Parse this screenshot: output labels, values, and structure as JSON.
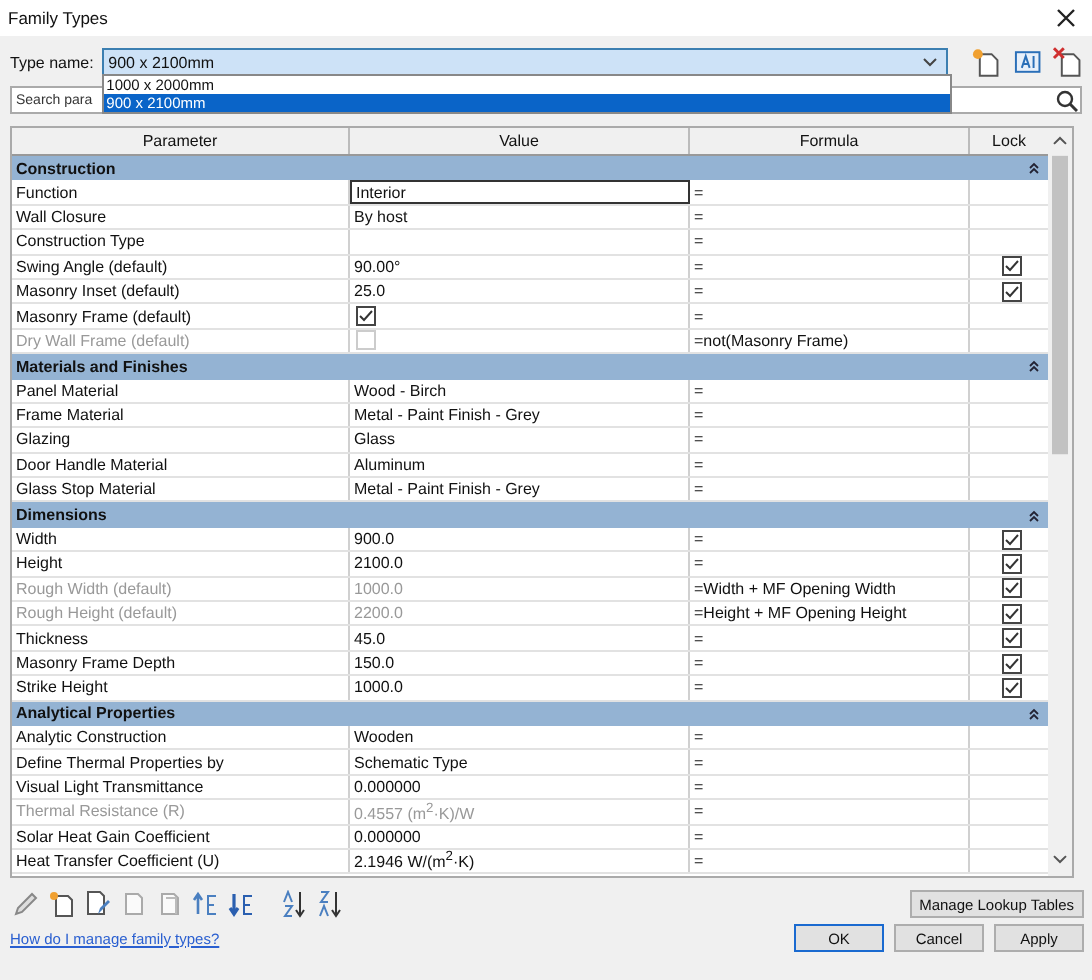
{
  "window": {
    "title": "Family Types"
  },
  "type_name": {
    "label": "Type name:",
    "value": "900 x 2100mm",
    "expanded": true,
    "options": [
      {
        "label": "1000 x 2000mm",
        "selected": false
      },
      {
        "label": "900 x 2100mm",
        "selected": true
      }
    ]
  },
  "search": {
    "placeholder": "Search para"
  },
  "table": {
    "columns": [
      "Parameter",
      "Value",
      "Formula",
      "Lock"
    ],
    "groups": [
      {
        "name": "Construction",
        "rows": [
          {
            "parameter": "Function",
            "kind": "text",
            "value": "Interior",
            "formula": "=",
            "locked": false,
            "disabled": false,
            "editing": true
          },
          {
            "parameter": "Wall Closure",
            "kind": "text",
            "value": "By host",
            "formula": "=",
            "locked": false,
            "disabled": false,
            "editing": false
          },
          {
            "parameter": "Construction Type",
            "kind": "text",
            "value": "",
            "formula": "=",
            "locked": false,
            "disabled": false,
            "editing": false
          },
          {
            "parameter": "Swing Angle (default)",
            "kind": "text",
            "value": "90.00°",
            "formula": "=",
            "locked": true,
            "disabled": false,
            "editing": false
          },
          {
            "parameter": "Masonry Inset (default)",
            "kind": "text",
            "value": "25.0",
            "formula": "=",
            "locked": true,
            "disabled": false,
            "editing": false
          },
          {
            "parameter": "Masonry Frame (default)",
            "kind": "checkbox",
            "checked": true,
            "formula": "=",
            "locked": false,
            "disabled": false,
            "editing": false
          },
          {
            "parameter": "Dry Wall Frame (default)",
            "kind": "checkbox",
            "checked": false,
            "formula": "=not(Masonry Frame)",
            "locked": false,
            "disabled": true,
            "editing": false
          }
        ]
      },
      {
        "name": "Materials and Finishes",
        "rows": [
          {
            "parameter": "Panel Material",
            "kind": "text",
            "value": "Wood - Birch",
            "formula": "=",
            "locked": false,
            "disabled": false,
            "editing": false
          },
          {
            "parameter": "Frame Material",
            "kind": "text",
            "value": "Metal - Paint Finish - Grey",
            "formula": "=",
            "locked": false,
            "disabled": false,
            "editing": false
          },
          {
            "parameter": "Glazing",
            "kind": "text",
            "value": "Glass",
            "formula": "=",
            "locked": false,
            "disabled": false,
            "editing": false
          },
          {
            "parameter": "Door Handle Material",
            "kind": "text",
            "value": "Aluminum",
            "formula": "=",
            "locked": false,
            "disabled": false,
            "editing": false
          },
          {
            "parameter": "Glass Stop Material",
            "kind": "text",
            "value": "Metal - Paint Finish - Grey",
            "formula": "=",
            "locked": false,
            "disabled": false,
            "editing": false
          }
        ]
      },
      {
        "name": "Dimensions",
        "rows": [
          {
            "parameter": "Width",
            "kind": "text",
            "value": "900.0",
            "formula": "=",
            "locked": true,
            "disabled": false,
            "editing": false
          },
          {
            "parameter": "Height",
            "kind": "text",
            "value": "2100.0",
            "formula": "=",
            "locked": true,
            "disabled": false,
            "editing": false
          },
          {
            "parameter": "Rough Width (default)",
            "kind": "text",
            "value": "1000.0",
            "formula": "=Width + MF Opening Width",
            "locked": true,
            "disabled": true,
            "editing": false
          },
          {
            "parameter": "Rough Height (default)",
            "kind": "text",
            "value": "2200.0",
            "formula": "=Height + MF Opening Height",
            "locked": true,
            "disabled": true,
            "editing": false
          },
          {
            "parameter": "Thickness",
            "kind": "text",
            "value": "45.0",
            "formula": "=",
            "locked": true,
            "disabled": false,
            "editing": false
          },
          {
            "parameter": "Masonry Frame Depth",
            "kind": "text",
            "value": "150.0",
            "formula": "=",
            "locked": true,
            "disabled": false,
            "editing": false
          },
          {
            "parameter": "Strike Height",
            "kind": "text",
            "value": "1000.0",
            "formula": "=",
            "locked": true,
            "disabled": false,
            "editing": false
          }
        ]
      },
      {
        "name": "Analytical Properties",
        "rows": [
          {
            "parameter": "Analytic Construction",
            "kind": "text",
            "value": "Wooden",
            "formula": "=",
            "locked": false,
            "disabled": false,
            "editing": false
          },
          {
            "parameter": "Define Thermal Properties by",
            "kind": "text",
            "value": "Schematic Type",
            "formula": "=",
            "locked": false,
            "disabled": false,
            "editing": false
          },
          {
            "parameter": "Visual Light Transmittance",
            "kind": "text",
            "value": "0.000000",
            "formula": "=",
            "locked": false,
            "disabled": false,
            "editing": false
          },
          {
            "parameter": "Thermal Resistance (R)",
            "kind": "text",
            "value": "0.4557 (m$^{2}$·K)/W",
            "formula": "=",
            "locked": false,
            "disabled": true,
            "editing": false
          },
          {
            "parameter": "Solar Heat Gain Coefficient",
            "kind": "text",
            "value": "0.000000",
            "formula": "=",
            "locked": false,
            "disabled": false,
            "editing": false
          },
          {
            "parameter": "Heat Transfer Coefficient (U)",
            "kind": "text",
            "value": "2.1946 W/(m$^{2}$·K)",
            "formula": "=",
            "locked": false,
            "disabled": false,
            "editing": false
          }
        ]
      }
    ]
  },
  "lookup_button": "Manage Lookup Tables",
  "help_link": "How do I manage family types?",
  "buttons": [
    {
      "label": "OK",
      "default": true
    },
    {
      "label": "Cancel",
      "default": false
    },
    {
      "label": "Apply",
      "default": false
    }
  ]
}
